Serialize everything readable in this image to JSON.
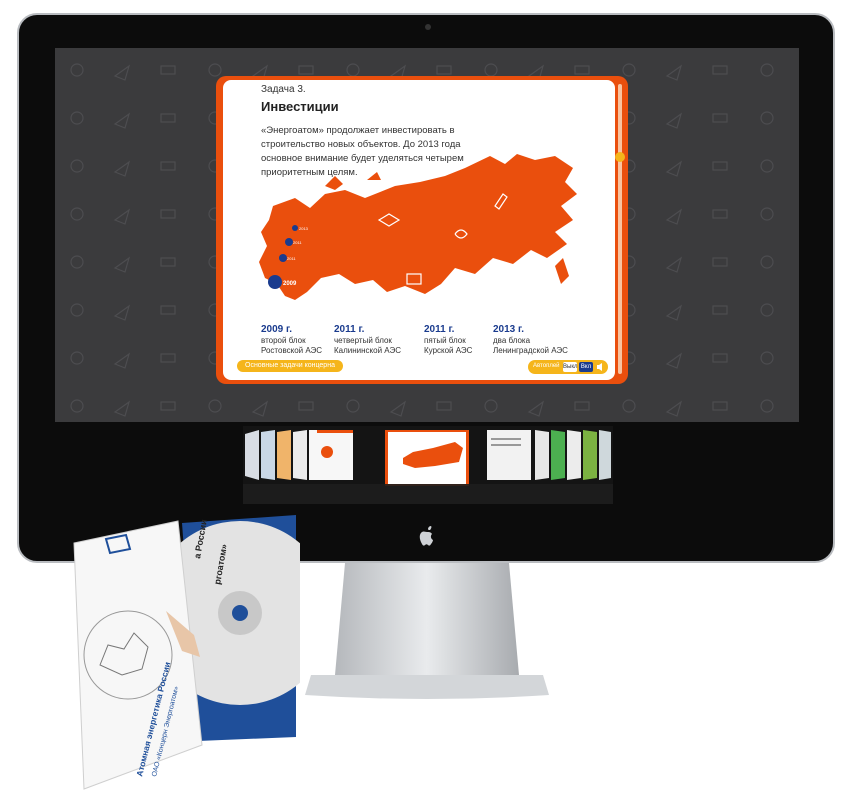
{
  "slide": {
    "task_label": "Задача 3.",
    "title": "Инвестиции",
    "body": "«Энергоатом» продолжает инвестировать в строительство новых объектов. До 2013 года основное внимание будет уделяться четырем приоритетным целям.",
    "map_markers": [
      "2013",
      "2011",
      "2011",
      "2009"
    ],
    "milestones": [
      {
        "year": "2009 г.",
        "line1": "второй блок",
        "line2": "Ростовской АЭС"
      },
      {
        "year": "2011 г.",
        "line1": "четвертый блок",
        "line2": "Калининской АЭС"
      },
      {
        "year": "2011 г.",
        "line1": "пятый блок",
        "line2": "Курской АЭС"
      },
      {
        "year": "2013 г.",
        "line1": "два блока",
        "line2": "Ленинградской АЭС"
      }
    ],
    "tasks_button": "Основные задачи концерна",
    "audio_label": "Автоплей",
    "audio_off": "Выкл",
    "audio_on": "Вкл"
  },
  "cd": {
    "line1": "Атомная энергетика России",
    "line2": "ОАО «Концерн Энергоатом»",
    "disc_text1": "а России",
    "disc_text2": "ргоатом»"
  },
  "colors": {
    "accent": "#ea4f0d",
    "navy": "#1a3b8e",
    "yellow": "#f5b51b",
    "screen_bg": "#3b3b3d"
  }
}
